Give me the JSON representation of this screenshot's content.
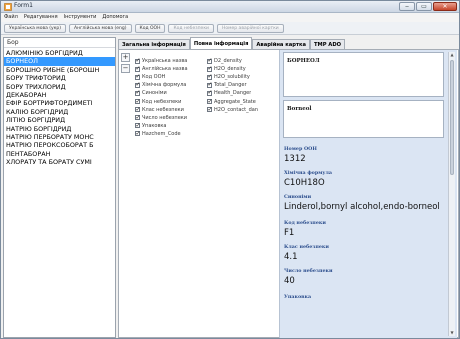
{
  "window": {
    "title": "Form1"
  },
  "menu": [
    "Файл",
    "Редагування",
    "Інструменти",
    "Допомога"
  ],
  "toolbar": {
    "buttons": [
      {
        "label": "Українська мова (укр)",
        "enabled": true
      },
      {
        "label": "Англійська мова (eng)",
        "enabled": true
      },
      {
        "label": "Код ООН",
        "enabled": true
      },
      {
        "label": "Код небезпеки",
        "enabled": false
      },
      {
        "label": "Номер аварійної картки",
        "enabled": false
      }
    ]
  },
  "sidebar": {
    "header": "Бор",
    "items": [
      "АЛЮМІНІЮ БОРГІДРИД",
      "БОРНЕОЛ",
      "БОРОШНО РИБНЕ (БОРОШН",
      "БОРУ ТРИФТОРИД",
      "БОРУ ТРИХЛОРИД",
      "ДЕКАБОРАН",
      "ЕФІР БОРТРИФТОРДИМЕТІ",
      "КАЛІЮ БОРГІДРИД",
      "ЛІТІЮ БОРГІДРИД",
      "НАТРІЮ БОРГІДРИД",
      "НАТРІЮ ПЕРБОРАТУ МОНС",
      "НАТРІЮ ПЕРОКСОБОРАТ Б",
      "ПЕНТАБОРАН",
      "ХЛОРАТУ ТА БОРАТУ СУМІ"
    ],
    "selected_index": 1
  },
  "tabs": [
    "Загальна інформація",
    "Повна інформація",
    "Аварійна картка",
    "ТМР ADO"
  ],
  "active_tab": 1,
  "side_buttons": [
    "+",
    "−"
  ],
  "checkboxes_left": [
    "Українська назва",
    "Англійська назва",
    "Код ООН",
    "Хімічна формула",
    "Синоніми",
    "Код небезпеки",
    "Клас небезпеки",
    "Число небезпеки",
    "Упаковка",
    "Hazchem_Code"
  ],
  "checkboxes_right": [
    "D2_density",
    "H2O_density",
    "H2O_solubility",
    "Total_Danger",
    "Health_Danger",
    "Aggregate_State",
    "H2O_contact_dan"
  ],
  "details": {
    "name_ua": "БОРНЕОЛ",
    "name_en": "Borneol",
    "un_label": "Номер ООН",
    "un_value": "1312",
    "formula_label": "Хімічна формула",
    "formula_value": "C10H18O",
    "synonyms_label": "Синоніми",
    "synonyms_value": "Linderol,bornyl alcohol,endo-borneol",
    "hazard_code_label": "Код небезпеки",
    "hazard_code_value": "F1",
    "hazard_class_label": "Клас небезпеки",
    "hazard_class_value": "4.1",
    "hazard_number_label": "Число небезпеки",
    "hazard_number_value": "40",
    "packaging_label": "Упаковка"
  },
  "colors": {
    "selection": "#3399ff",
    "details_bg": "#dbe5f3",
    "field_label": "#2b4d8c"
  }
}
